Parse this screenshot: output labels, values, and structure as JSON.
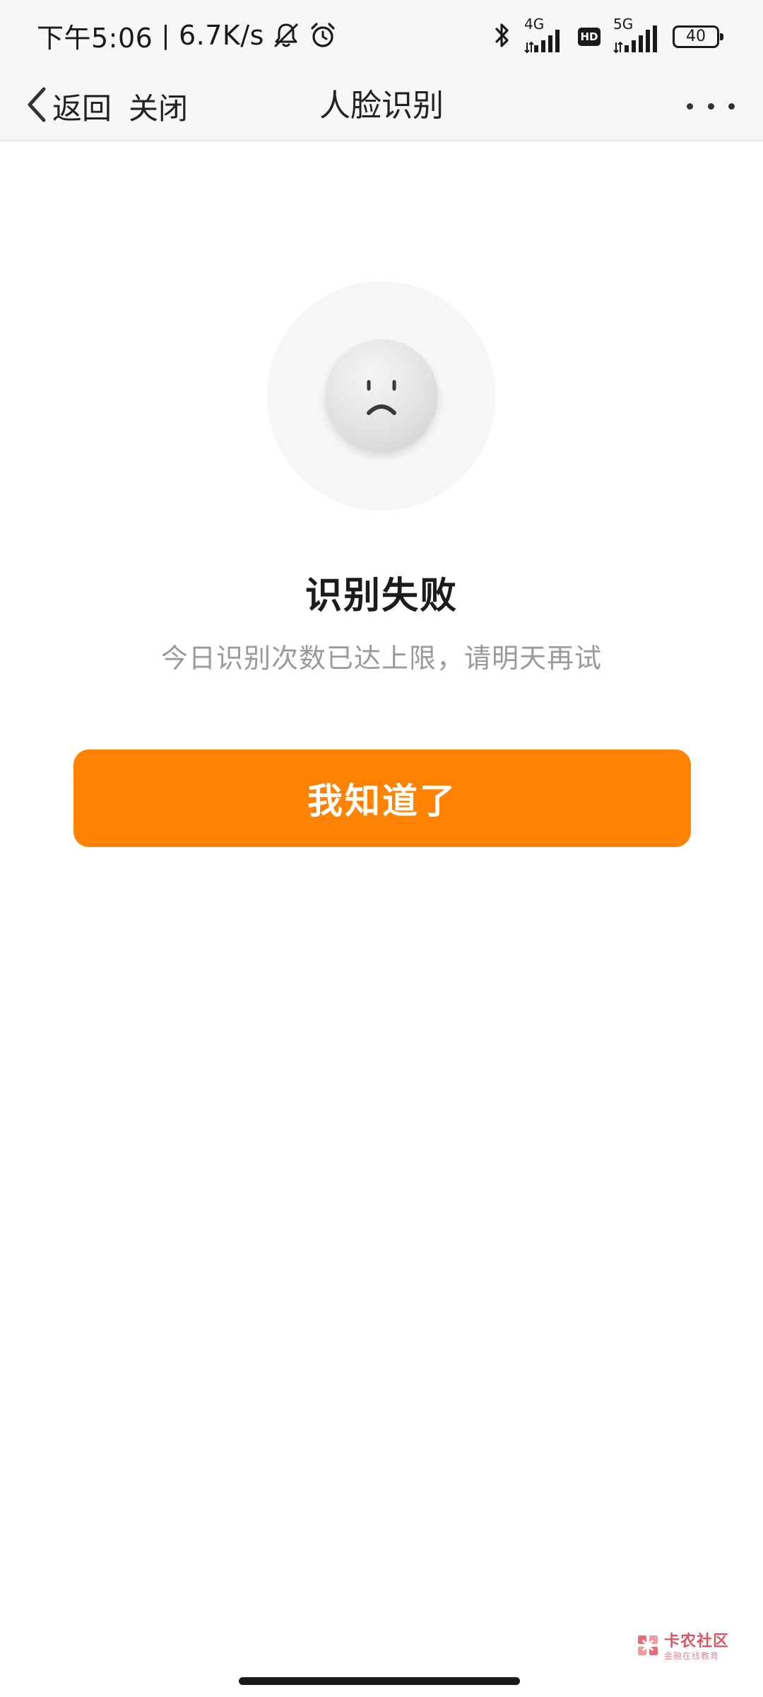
{
  "status_bar": {
    "time": "下午5:06",
    "separator": "|",
    "net_speed": "6.7K/s",
    "network_4g_label": "4G",
    "hd_label": "HD",
    "network_5g_label": "5G",
    "battery_level": "40",
    "icons": [
      "bell-muted-icon",
      "alarm-icon",
      "bluetooth-icon",
      "signal-icon",
      "battery-icon"
    ]
  },
  "nav": {
    "back_label": "返回",
    "close_label": "关闭",
    "title": "人脸识别",
    "more_icon": "more-dots-icon"
  },
  "result": {
    "icon": "sad-face-icon",
    "title": "识别失败",
    "subtitle": "今日识别次数已达上限，请明天再试",
    "button_label": "我知道了"
  },
  "watermark": {
    "main": "卡农社区",
    "sub": "金融在线教育"
  },
  "colors": {
    "accent": "#ff8200",
    "title_text": "#1c1c1c",
    "subtitle_text": "#9a9a9a",
    "bar_background": "#f7f7f7"
  }
}
